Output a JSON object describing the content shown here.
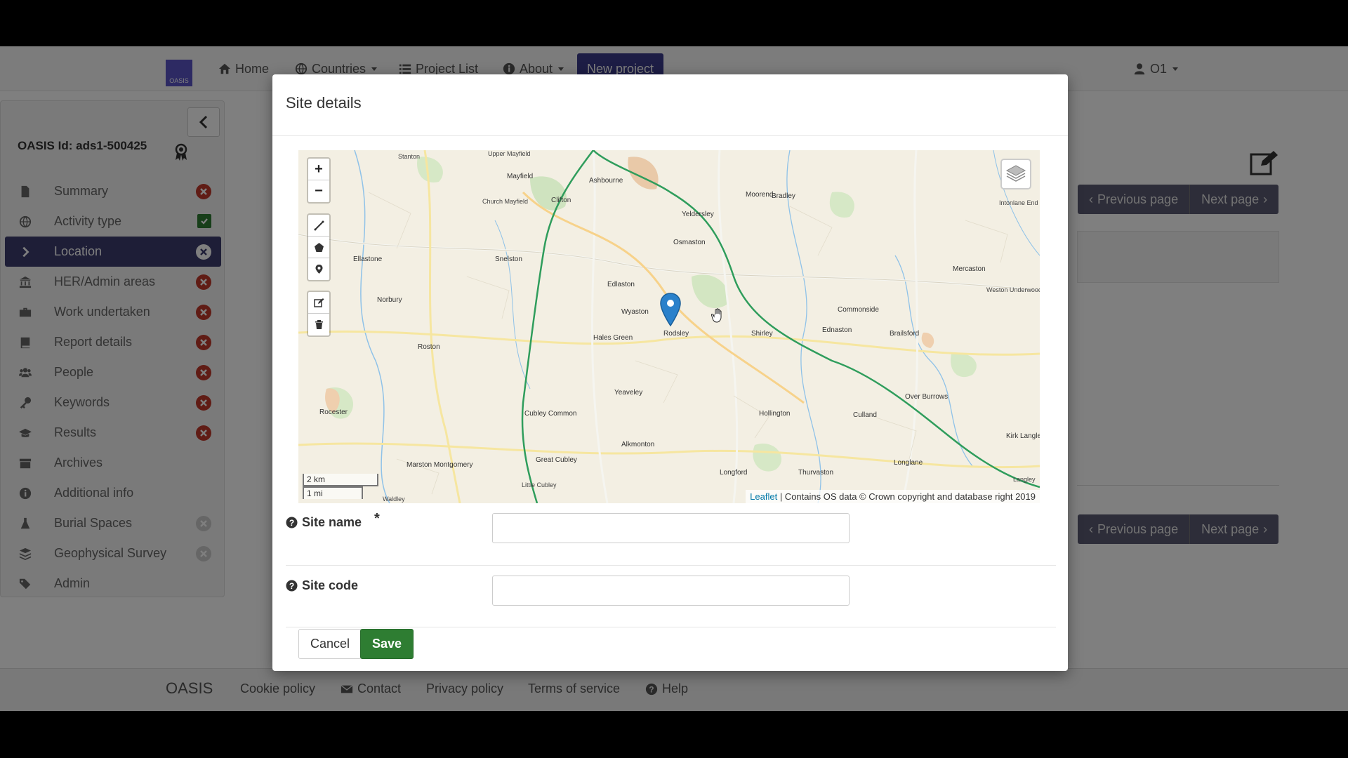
{
  "colors": {
    "brand": "#3d3d6e",
    "error": "#c0392b",
    "success": "#2e7d32",
    "overlay": "rgba(0,0,0,0.5)"
  },
  "navbar": {
    "logo_text": "OASIS",
    "items": [
      {
        "label": "Home",
        "icon": "home-icon"
      },
      {
        "label": "Countries",
        "icon": "globe-icon",
        "dropdown": true
      },
      {
        "label": "Project List",
        "icon": "list-icon"
      },
      {
        "label": "About",
        "icon": "info-icon",
        "dropdown": true
      }
    ],
    "new_project_label": "New project",
    "user_label": "O1"
  },
  "sidebar": {
    "oasis_id": "OASIS Id: ads1-500425",
    "items": [
      {
        "label": "Summary",
        "icon": "file-icon",
        "status": "error"
      },
      {
        "label": "Activity type",
        "icon": "globe-icon",
        "status": "complete"
      },
      {
        "label": "Location",
        "icon": "chevron-right-icon",
        "status": "error",
        "active": true
      },
      {
        "label": "HER/Admin areas",
        "icon": "institution-icon",
        "status": "error"
      },
      {
        "label": "Work undertaken",
        "icon": "briefcase-icon",
        "status": "error"
      },
      {
        "label": "Report details",
        "icon": "book-icon",
        "status": "error"
      },
      {
        "label": "People",
        "icon": "users-icon",
        "status": "error"
      },
      {
        "label": "Keywords",
        "icon": "key-icon",
        "status": "error"
      },
      {
        "label": "Results",
        "icon": "graduation-cap-icon",
        "status": "error"
      },
      {
        "label": "Archives",
        "icon": "archive-icon",
        "status": "none"
      },
      {
        "label": "Additional info",
        "icon": "info-circle-icon",
        "status": "none"
      },
      {
        "label": "Burial Spaces",
        "icon": "flask-icon",
        "status": "disabled"
      },
      {
        "label": "Geophysical Survey",
        "icon": "layers-icon",
        "status": "disabled"
      },
      {
        "label": "Admin",
        "icon": "tags-icon",
        "status": "none"
      }
    ]
  },
  "main": {
    "previous_page_label": "Previous page",
    "next_page_label": "Next page"
  },
  "modal": {
    "title": "Site details",
    "map": {
      "zoom_in": "+",
      "zoom_out": "−",
      "scale_km": "2 km",
      "scale_mi": "1 mi",
      "attribution_link": "Leaflet",
      "attribution_text": " | Contains OS data © Crown copyright and database right 2019",
      "places": [
        "Stanton",
        "Upper Mayfield",
        "Mayfield",
        "Clifton",
        "Ashbourne",
        "Church Mayfield",
        "Snelston",
        "Ellastone",
        "Norbury",
        "Edlaston",
        "Wyaston",
        "Osmaston",
        "Yeldersley",
        "Moorend",
        "Bradley",
        "Hales Green",
        "Rodsley",
        "Shirley",
        "Roston",
        "Ednaston",
        "Commonside",
        "Brailsford",
        "Mercaston",
        "Weston Underwood",
        "Yeaveley",
        "Hollington",
        "Culland",
        "Over Burrows",
        "Cubley Common",
        "Alkmonton",
        "Great Cubley",
        "Marston Montgomery",
        "Longford",
        "Thurvaston",
        "Longlane",
        "Rocester",
        "Waldley",
        "Little Cubley",
        "Intonlane End",
        "Kirk Langley",
        "Langley"
      ]
    },
    "site_name": {
      "label": "Site name",
      "required_mark": "*",
      "value": "",
      "placeholder": ""
    },
    "site_code": {
      "label": "Site code",
      "value": "",
      "placeholder": ""
    },
    "cancel_label": "Cancel",
    "save_label": "Save"
  },
  "footer": {
    "brand": "OASIS",
    "links": [
      {
        "label": "Cookie policy",
        "icon": ""
      },
      {
        "label": "Contact",
        "icon": "envelope-icon"
      },
      {
        "label": "Privacy policy",
        "icon": ""
      },
      {
        "label": "Terms of service",
        "icon": ""
      },
      {
        "label": "Help",
        "icon": "question-circle-icon"
      }
    ]
  }
}
